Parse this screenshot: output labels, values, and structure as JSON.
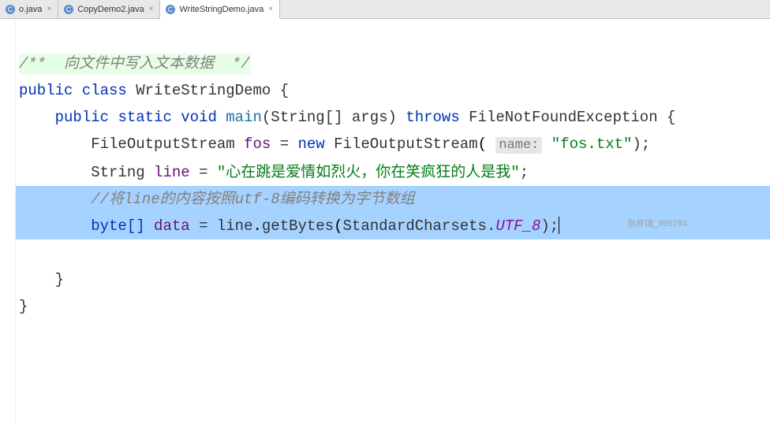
{
  "tabs": [
    {
      "label": "o.java",
      "active": false
    },
    {
      "label": "CopyDemo2.java",
      "active": false
    },
    {
      "label": "WriteStringDemo.java",
      "active": true
    }
  ],
  "code": {
    "doc_comment": "/**  向文件中写入文本数据  */",
    "kw_public": "public",
    "kw_class": "class",
    "class_name": "WriteStringDemo",
    "brace_open": "{",
    "kw_static": "static",
    "kw_void": "void",
    "method_main": "main",
    "main_sig_open": "(String[] args)",
    "kw_throws": "throws",
    "exception": "FileNotFoundException",
    "brace_open2": "{",
    "line4": {
      "type1": "FileOutputStream",
      "var1": "fos",
      "eq": "=",
      "kw_new": "new",
      "type2": "FileOutputStream",
      "hint": "name:",
      "str": "\"fos.txt\"",
      "end": ");"
    },
    "line5": {
      "type": "String",
      "var": "line",
      "eq": "=",
      "str": "\"心在跳是爱情如烈火，你在笑疯狂的人是我\"",
      "end": ";"
    },
    "line6_comment": "//将line的内容按照utf-8编码转换为字节数组",
    "line7": {
      "type": "byte[]",
      "var": "data",
      "eq": "=",
      "obj": "line",
      "method": "getBytes",
      "arg_class": "StandardCharsets",
      "dot": ".",
      "arg_const": "UTF_8",
      "end": ");"
    },
    "brace_close_inner": "}",
    "brace_close_outer": "}"
  },
  "watermark": "张井瑞_999784"
}
